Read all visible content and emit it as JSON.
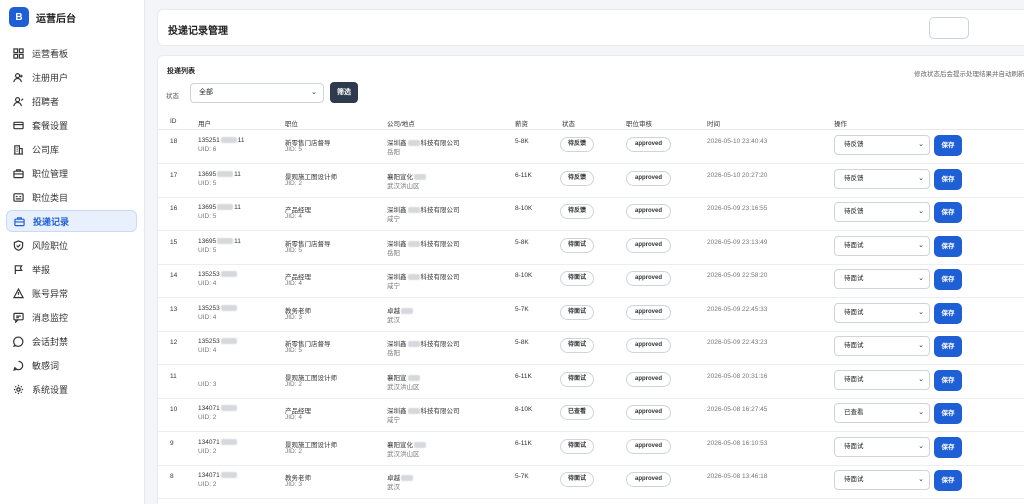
{
  "brand": {
    "logo": "B",
    "title": "运营后台"
  },
  "nav": [
    {
      "label": "运营看板",
      "icon": "dashboard-icon",
      "name": "nav-dashboard"
    },
    {
      "label": "注册用户",
      "icon": "user-icon",
      "name": "nav-users"
    },
    {
      "label": "招聘者",
      "icon": "recruiter-icon",
      "name": "nav-recruiters"
    },
    {
      "label": "套餐设置",
      "icon": "card-icon",
      "name": "nav-packages"
    },
    {
      "label": "公司库",
      "icon": "building-icon",
      "name": "nav-companies"
    },
    {
      "label": "职位管理",
      "icon": "briefcase-icon",
      "name": "nav-jobs"
    },
    {
      "label": "职位类目",
      "icon": "category-icon",
      "name": "nav-job-categories"
    },
    {
      "label": "投递记录",
      "icon": "briefcase-icon",
      "name": "nav-applications",
      "active": true
    },
    {
      "label": "风险职位",
      "icon": "shield-icon",
      "name": "nav-risk-jobs"
    },
    {
      "label": "举报",
      "icon": "flag-icon",
      "name": "nav-reports"
    },
    {
      "label": "账号异常",
      "icon": "warning-icon",
      "name": "nav-account-anomaly"
    },
    {
      "label": "消息监控",
      "icon": "message-icon",
      "name": "nav-message-monitor"
    },
    {
      "label": "会话封禁",
      "icon": "chat-ban-icon",
      "name": "nav-session-ban"
    },
    {
      "label": "敏感词",
      "icon": "word-icon",
      "name": "nav-sensitive-words"
    },
    {
      "label": "系统设置",
      "icon": "gear-icon",
      "name": "nav-settings"
    }
  ],
  "header": {
    "title": "投递记录管理",
    "button_label": ""
  },
  "list": {
    "section_title": "投递列表",
    "hint": "修改状态后会提示处理结果并自动刷新",
    "filter_label": "状态",
    "filter_value": "全部",
    "filter_button": "筛选"
  },
  "columns": [
    "ID",
    "用户",
    "职位",
    "公司/地点",
    "薪资",
    "状态",
    "职位审核",
    "时间",
    "操作"
  ],
  "save_label": "保存",
  "rows": [
    {
      "id": "18",
      "user": "135251",
      "user_tail": "11",
      "uid": "UID: 6",
      "job": "新零售门店督导",
      "jid": "JID: 5",
      "company": "深圳鑫",
      "company_tail": "科技有限公司",
      "location": "岳阳",
      "salary": "5-8K",
      "status": "待反馈",
      "review": "approved",
      "time": "2026-05-10 23:40:43",
      "action": "待反馈"
    },
    {
      "id": "17",
      "user": "13695",
      "user_tail": "11",
      "uid": "UID: 5",
      "job": "景观施工图设计师",
      "jid": "JID: 2",
      "company": "襄阳宣化",
      "company_tail": "",
      "location": "武汉洪山区",
      "salary": "6-11K",
      "status": "待反馈",
      "review": "approved",
      "time": "2026-05-10 20:27:20",
      "action": "待反馈"
    },
    {
      "id": "16",
      "user": "13695",
      "user_tail": "11",
      "uid": "UID: 5",
      "job": "产品经理",
      "jid": "JID: 4",
      "company": "深圳鑫",
      "company_tail": "科技有限公司",
      "location": "咸宁",
      "salary": "8-10K",
      "status": "待反馈",
      "review": "approved",
      "time": "2026-05-09 23:16:55",
      "action": "待反馈"
    },
    {
      "id": "15",
      "user": "13695",
      "user_tail": "11",
      "uid": "UID: 5",
      "job": "新零售门店督导",
      "jid": "JID: 5",
      "company": "深圳鑫",
      "company_tail": "科技有限公司",
      "location": "岳阳",
      "salary": "5-8K",
      "status": "待面试",
      "review": "approved",
      "time": "2026-05-09 23:13:49",
      "action": "待面试"
    },
    {
      "id": "14",
      "user": "135253",
      "user_tail": "",
      "uid": "UID: 4",
      "job": "产品经理",
      "jid": "JID: 4",
      "company": "深圳鑫",
      "company_tail": "科技有限公司",
      "location": "咸宁",
      "salary": "8-10K",
      "status": "待面试",
      "review": "approved",
      "time": "2026-05-09 22:58:20",
      "action": "待面试"
    },
    {
      "id": "13",
      "user": "135253",
      "user_tail": "",
      "uid": "UID: 4",
      "job": "教务老师",
      "jid": "JID: 3",
      "company": "卓越",
      "company_tail": "",
      "location": "武汉",
      "salary": "5-7K",
      "status": "待面试",
      "review": "approved",
      "time": "2026-05-09 22:45:33",
      "action": "待面试"
    },
    {
      "id": "12",
      "user": "135253",
      "user_tail": "",
      "uid": "UID: 4",
      "job": "新零售门店督导",
      "jid": "JID: 5",
      "company": "深圳鑫",
      "company_tail": "科技有限公司",
      "location": "岳阳",
      "salary": "5-8K",
      "status": "待面试",
      "review": "approved",
      "time": "2026-05-09 22:43:23",
      "action": "待面试"
    },
    {
      "id": "11",
      "user": "",
      "user_tail": "",
      "uid": "UID: 3",
      "job": "景观施工图设计师",
      "jid": "JID: 2",
      "company": "襄阳宣",
      "company_tail": "",
      "location": "武汉洪山区",
      "salary": "6-11K",
      "status": "待面试",
      "review": "approved",
      "time": "2026-05-08 20:31:16",
      "action": "待面试"
    },
    {
      "id": "10",
      "user": "134071",
      "user_tail": "",
      "uid": "UID: 2",
      "job": "产品经理",
      "jid": "JID: 4",
      "company": "深圳鑫",
      "company_tail": "科技有限公司",
      "location": "咸宁",
      "salary": "8-10K",
      "status": "已查看",
      "review": "approved",
      "time": "2026-05-08 16:27:45",
      "action": "已查看"
    },
    {
      "id": "9",
      "user": "134071",
      "user_tail": "",
      "uid": "UID: 2",
      "job": "景观施工图设计师",
      "jid": "JID: 2",
      "company": "襄阳宣化",
      "company_tail": "",
      "location": "武汉洪山区",
      "salary": "6-11K",
      "status": "待面试",
      "review": "approved",
      "time": "2026-05-08 16:10:53",
      "action": "待面试"
    },
    {
      "id": "8",
      "user": "134071",
      "user_tail": "",
      "uid": "UID: 2",
      "job": "教务老师",
      "jid": "JID: 3",
      "company": "卓越",
      "company_tail": "",
      "location": "武汉",
      "salary": "5-7K",
      "status": "待面试",
      "review": "approved",
      "time": "2026-05-08 13:46:18",
      "action": "待面试"
    }
  ]
}
